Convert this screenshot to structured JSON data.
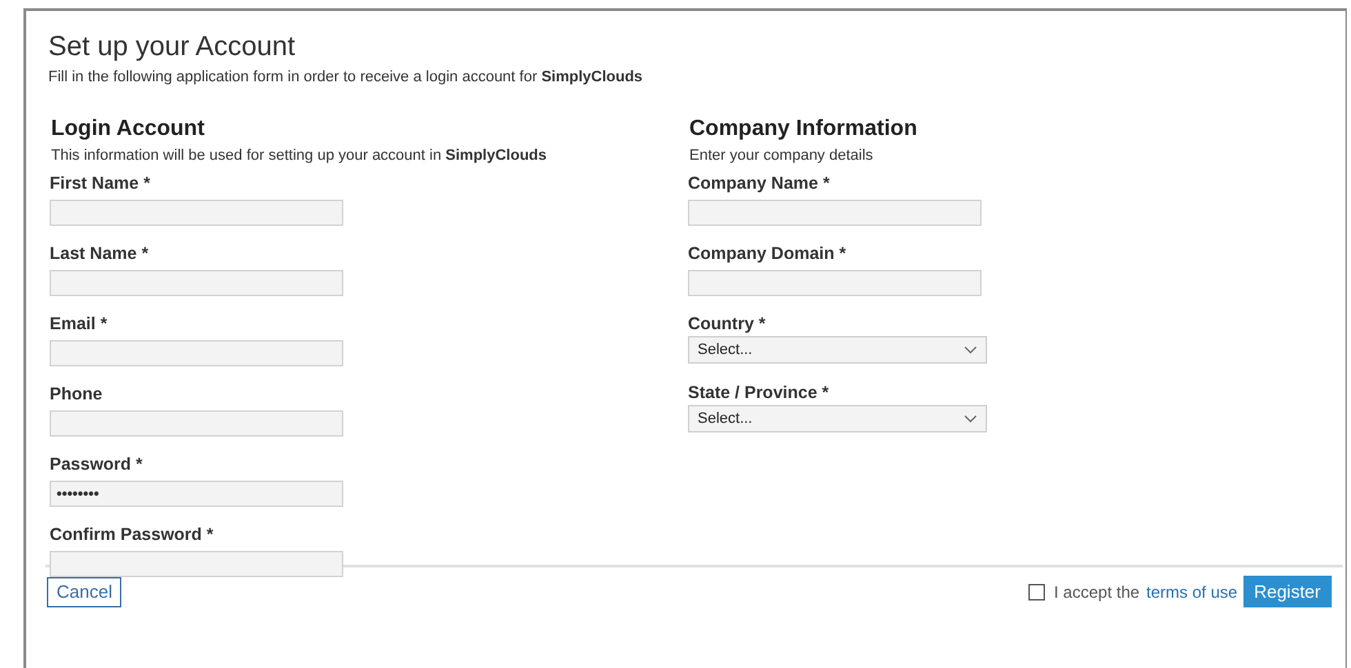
{
  "title": "Set up your Account",
  "subtitle": "Fill in the following application form in order to receive a login account for **SimplyClouds**",
  "sections": [
    {
      "heading": "Login Account",
      "description": "This information will be used for setting up your account in **SimplyClouds**",
      "fields": [
        {
          "kind": "text",
          "label": "First Name *"
        },
        {
          "kind": "text",
          "label": "Last Name *"
        },
        {
          "kind": "text",
          "label": "Email *"
        },
        {
          "kind": "text",
          "label": "Phone"
        },
        {
          "kind": "text",
          "label": "Password *",
          "value": "••••••••"
        },
        {
          "kind": "text",
          "label": "Confirm Password *"
        }
      ]
    },
    {
      "heading": "Company Information",
      "description": "Enter your company details",
      "fields": [
        {
          "kind": "text",
          "label": "Company Name *"
        },
        {
          "kind": "text",
          "label": "Company Domain *"
        },
        {
          "kind": "select",
          "label": "Country *",
          "value": "Select..."
        },
        {
          "kind": "select",
          "label": "State / Province *",
          "value": "Select..."
        }
      ]
    }
  ],
  "footer": {
    "cancel": "Cancel",
    "terms_checked": false,
    "terms_prefix": "I accept the",
    "terms_link": "terms of use",
    "register": "Register"
  }
}
